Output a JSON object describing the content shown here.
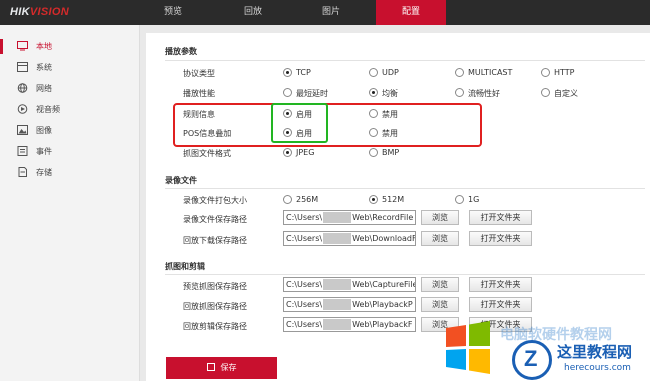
{
  "brand": {
    "left": "HIK",
    "right": "VISION"
  },
  "nav": [
    "预览",
    "回放",
    "图片",
    "配置"
  ],
  "sidebar": [
    {
      "label": "本地",
      "icon": "monitor-icon"
    },
    {
      "label": "系统",
      "icon": "system-icon"
    },
    {
      "label": "网络",
      "icon": "globe-icon"
    },
    {
      "label": "视音频",
      "icon": "audio-video-icon"
    },
    {
      "label": "图像",
      "icon": "image-icon"
    },
    {
      "label": "事件",
      "icon": "event-icon"
    },
    {
      "label": "存储",
      "icon": "storage-icon"
    }
  ],
  "playback": {
    "title": "播放参数",
    "protocol": {
      "label": "协议类型",
      "options": [
        "TCP",
        "UDP",
        "MULTICAST",
        "HTTP"
      ],
      "selected": "TCP"
    },
    "performance": {
      "label": "播放性能",
      "options": [
        "最短延时",
        "均衡",
        "流畅性好",
        "自定义"
      ],
      "selected": "均衡"
    },
    "rules": {
      "label": "规则信息",
      "options": [
        "启用",
        "禁用"
      ],
      "selected": "启用"
    },
    "pos": {
      "label": "POS信息叠加",
      "options": [
        "启用",
        "禁用"
      ],
      "selected": "启用"
    },
    "format": {
      "label": "抓图文件格式",
      "options": [
        "JPEG",
        "BMP"
      ],
      "selected": "JPEG"
    }
  },
  "record": {
    "title": "录像文件",
    "size": {
      "label": "录像文件打包大小",
      "options": [
        "256M",
        "512M",
        "1G"
      ],
      "selected": "512M"
    },
    "save_path": {
      "label": "录像文件保存路径",
      "prefix": "C:\\Users\\",
      "suffix": "Web\\RecordFile"
    },
    "download_path": {
      "label": "回放下载保存路径",
      "prefix": "C:\\Users\\",
      "suffix": "Web\\DownloadF"
    }
  },
  "capture": {
    "title": "抓图和剪辑",
    "preview_path": {
      "label": "预览抓图保存路径",
      "prefix": "C:\\Users\\",
      "suffix": "Web\\CaptureFile"
    },
    "playback_path": {
      "label": "回放抓图保存路径",
      "prefix": "C:\\Users\\",
      "suffix": "Web\\PlaybackP"
    },
    "clip_path": {
      "label": "回放剪辑保存路径",
      "prefix": "C:\\Users\\",
      "suffix": "Web\\PlaybackF"
    }
  },
  "buttons": {
    "browse": "浏览",
    "open_folder": "打开文件夹",
    "save": "保存"
  },
  "watermark": {
    "overlay": "电脑软硬件教程网",
    "title": "这里教程网",
    "url": "herecours.com",
    "logo_letter": "Z"
  },
  "colors": {
    "accent": "#c8102e",
    "highlight_red": "#e02020",
    "highlight_green": "#22b522",
    "watermark_blue": "#1a5fb4"
  }
}
